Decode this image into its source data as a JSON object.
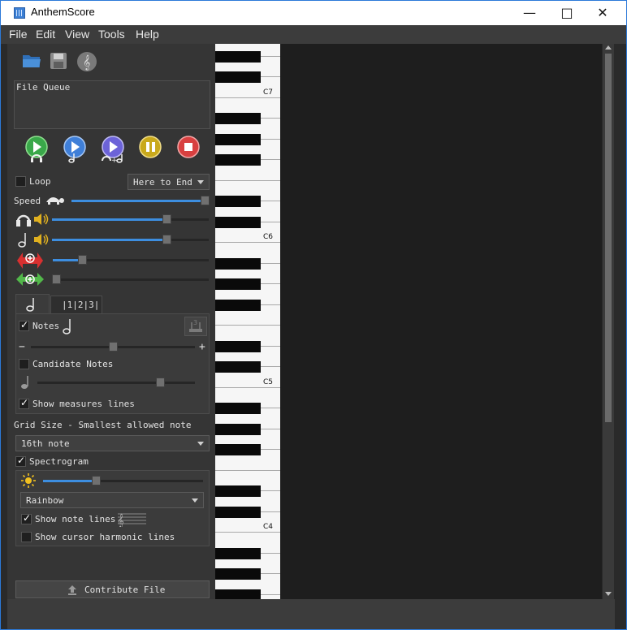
{
  "window": {
    "title": "AnthemScore"
  },
  "menu": [
    "File",
    "Edit",
    "View",
    "Tools",
    "Help"
  ],
  "toolbar": {
    "icons": [
      "open-folder-icon",
      "save-icon",
      "treble-clef-icon"
    ]
  },
  "file_queue": {
    "label": "File Queue"
  },
  "playback": {
    "buttons": [
      "play-audio",
      "play-notes",
      "play-audio-and-notes",
      "pause",
      "stop"
    ],
    "loop_label": "Loop",
    "loop_checked": false,
    "range_value": "Here to End",
    "speed_label": "Speed",
    "speed_level": 1.0,
    "audio_volume_level": 0.73,
    "notes_volume_level": 0.73,
    "pitch_zoom_level": 0.19,
    "time_zoom_level": 0.02
  },
  "notes_panel": {
    "tab_notes_icon": "note-icon",
    "tab_measures_label": "|1|2|3|",
    "notes_label": "Notes",
    "notes_checked": true,
    "minus": "−",
    "plus": "+",
    "notes_threshold_level": 0.5,
    "candidate_label": "Candidate Notes",
    "candidate_checked": false,
    "candidate_threshold_level": 0.78,
    "show_measures_label": "Show measures lines",
    "show_measures_checked": true
  },
  "grid": {
    "label": "Grid Size - Smallest allowed note",
    "value": "16th note"
  },
  "spectrogram": {
    "label": "Spectrogram",
    "checked": true,
    "brightness_level": 0.33,
    "colormap": "Rainbow",
    "show_note_lines_label": "Show note lines",
    "show_note_lines_checked": true,
    "show_cursor_harmonic_label": "Show cursor harmonic lines",
    "show_cursor_harmonic_checked": false
  },
  "contribute": {
    "label": "Contribute File"
  },
  "piano": {
    "labels": [
      "C7",
      "C6",
      "C5",
      "C4"
    ]
  }
}
